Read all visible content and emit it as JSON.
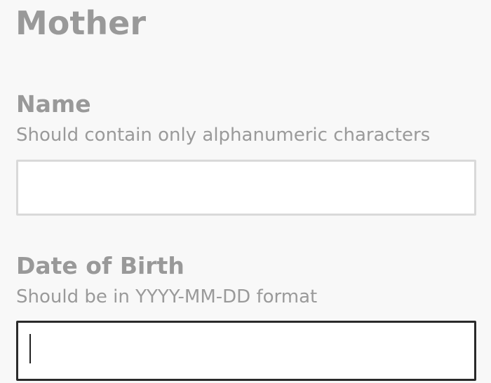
{
  "section": {
    "title": "Mother"
  },
  "fields": {
    "name": {
      "label": "Name",
      "hint": "Should contain only alphanumeric characters",
      "value": "",
      "placeholder": ""
    },
    "dob": {
      "label": "Date of Birth",
      "hint": "Should be in YYYY-MM-DD format",
      "value": "",
      "placeholder": ""
    }
  }
}
